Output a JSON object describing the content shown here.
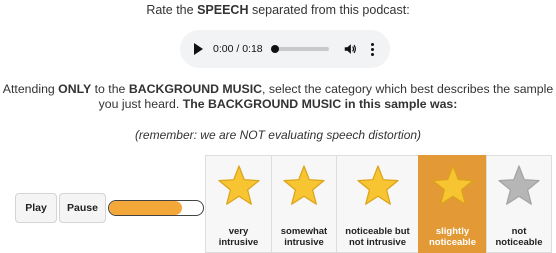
{
  "header": {
    "pre": "Rate the ",
    "bold": "SPEECH",
    "post": " separated from this podcast:"
  },
  "audio": {
    "time": "0:00 / 0:18",
    "progress_fraction": 0.0
  },
  "instruction": {
    "p1": "Attending ",
    "b1": "ONLY",
    "p2": " to the ",
    "b2": "BACKGROUND MUSIC",
    "p3": ", select the category which best describes the sample you just heard. ",
    "b3": "The BACKGROUND MUSIC in this sample was:"
  },
  "reminder": "(remember: we are NOT evaluating speech distortion)",
  "controls": {
    "play_label": "Play",
    "pause_label": "Pause",
    "playback_fraction": 0.78
  },
  "rating": {
    "options": [
      {
        "line1": "very",
        "line2": "intrusive",
        "width": 66
      },
      {
        "line1": "somewhat",
        "line2": "intrusive",
        "width": 65
      },
      {
        "line1": "noticeable but",
        "line2": "not intrusive",
        "width": 82
      },
      {
        "line1": "slightly",
        "line2": "noticeable",
        "width": 68
      },
      {
        "line1": "not",
        "line2": "noticeable",
        "width": 66
      }
    ],
    "selected_index": 3
  },
  "colors": {
    "star": "#f7c531",
    "star_stroke": "#dca21a",
    "star_inactive": "#b6b6b6",
    "selected_bg": "#e39a36",
    "progress": "#f4a83a"
  }
}
